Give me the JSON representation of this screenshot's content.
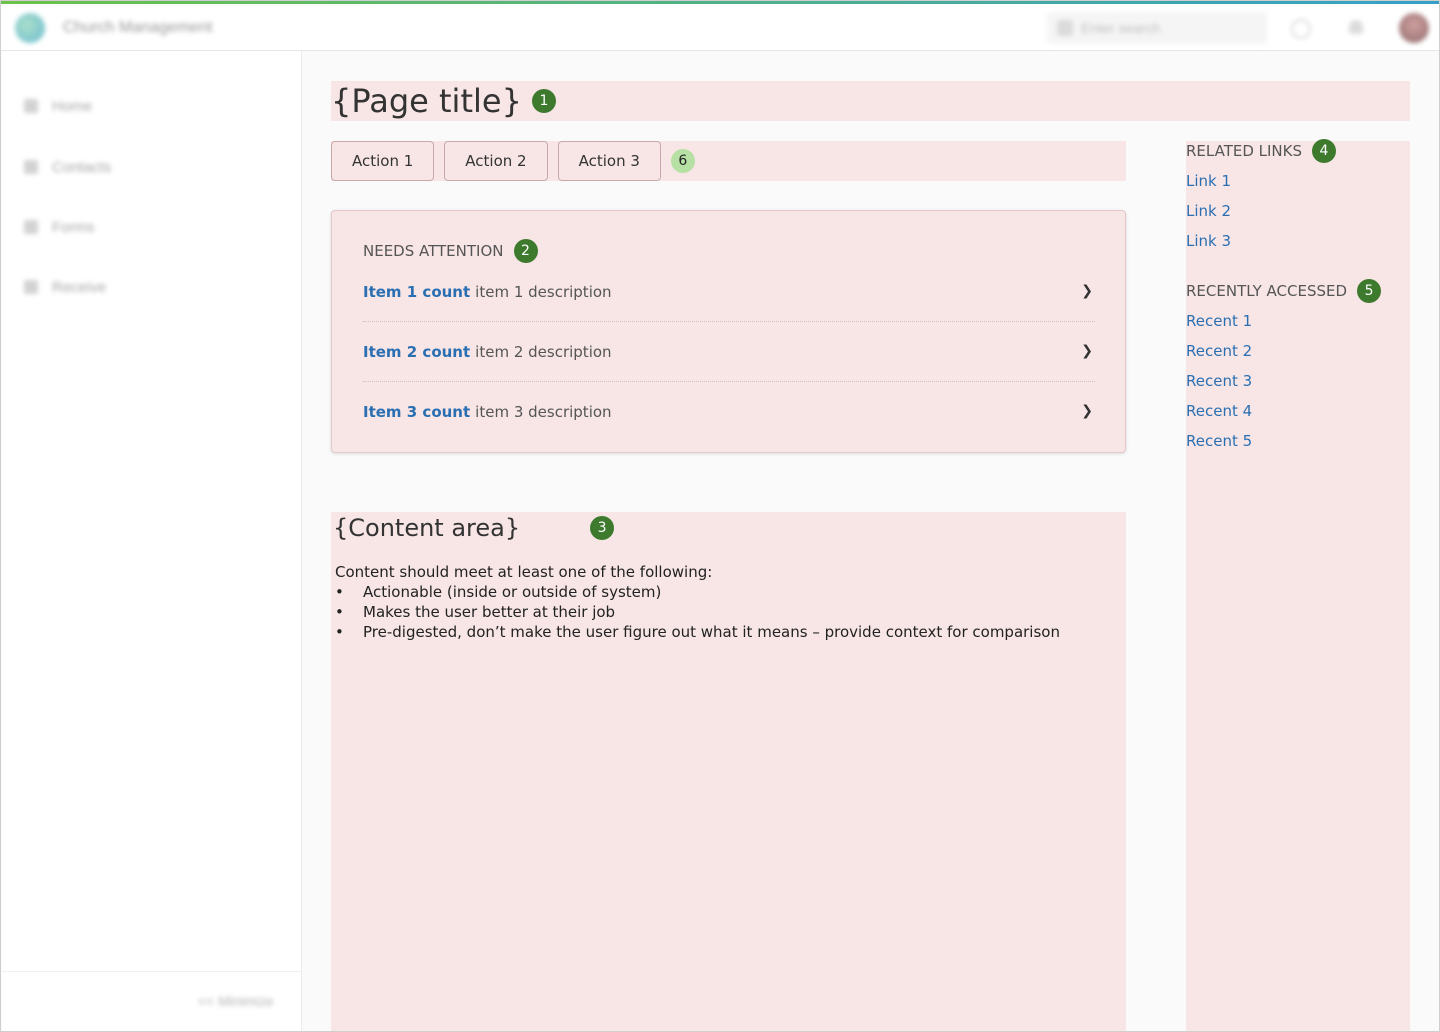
{
  "app": {
    "title": "Church Management",
    "search_placeholder": "Enter search"
  },
  "sidebar": {
    "items": [
      {
        "label": "Home"
      },
      {
        "label": "Contacts"
      },
      {
        "label": "Forms"
      },
      {
        "label": "Receive"
      }
    ],
    "minimize_label": "<< Minimize"
  },
  "page": {
    "title": "{Page title}",
    "title_badge": "1"
  },
  "actions": {
    "items": [
      {
        "label": "Action 1"
      },
      {
        "label": "Action 2"
      },
      {
        "label": "Action 3"
      }
    ],
    "badge": "6"
  },
  "needs_attention": {
    "heading": "NEEDS ATTENTION",
    "badge": "2",
    "items": [
      {
        "count": "Item 1 count",
        "description": "item 1 description"
      },
      {
        "count": "Item 2 count",
        "description": "item 2 description"
      },
      {
        "count": "Item 3 count",
        "description": "item 3 description"
      }
    ]
  },
  "content_area": {
    "title": "{Content area}",
    "badge": "3",
    "intro": "Content should meet at least one of the following:",
    "bullets": [
      "Actionable (inside or outside of system)",
      "Makes the user better at their job",
      "Pre-digested, don’t make the user figure out what it means – provide context for comparison"
    ]
  },
  "related_links": {
    "heading": "RELATED LINKS",
    "badge": "4",
    "links": [
      "Link 1",
      "Link 2",
      "Link 3"
    ]
  },
  "recently_accessed": {
    "heading": "RECENTLY ACCESSED",
    "badge": "5",
    "links": [
      "Recent 1",
      "Recent 2",
      "Recent 3",
      "Recent 4",
      "Recent 5"
    ]
  },
  "colors": {
    "annotation_fill": "#f8e6e6",
    "badge": "#3e7a2e",
    "badge_light": "#b6e0a4",
    "link": "#2a6fb2",
    "accent_gradient_start": "#6cc24a",
    "accent_gradient_end": "#34a0c8"
  }
}
